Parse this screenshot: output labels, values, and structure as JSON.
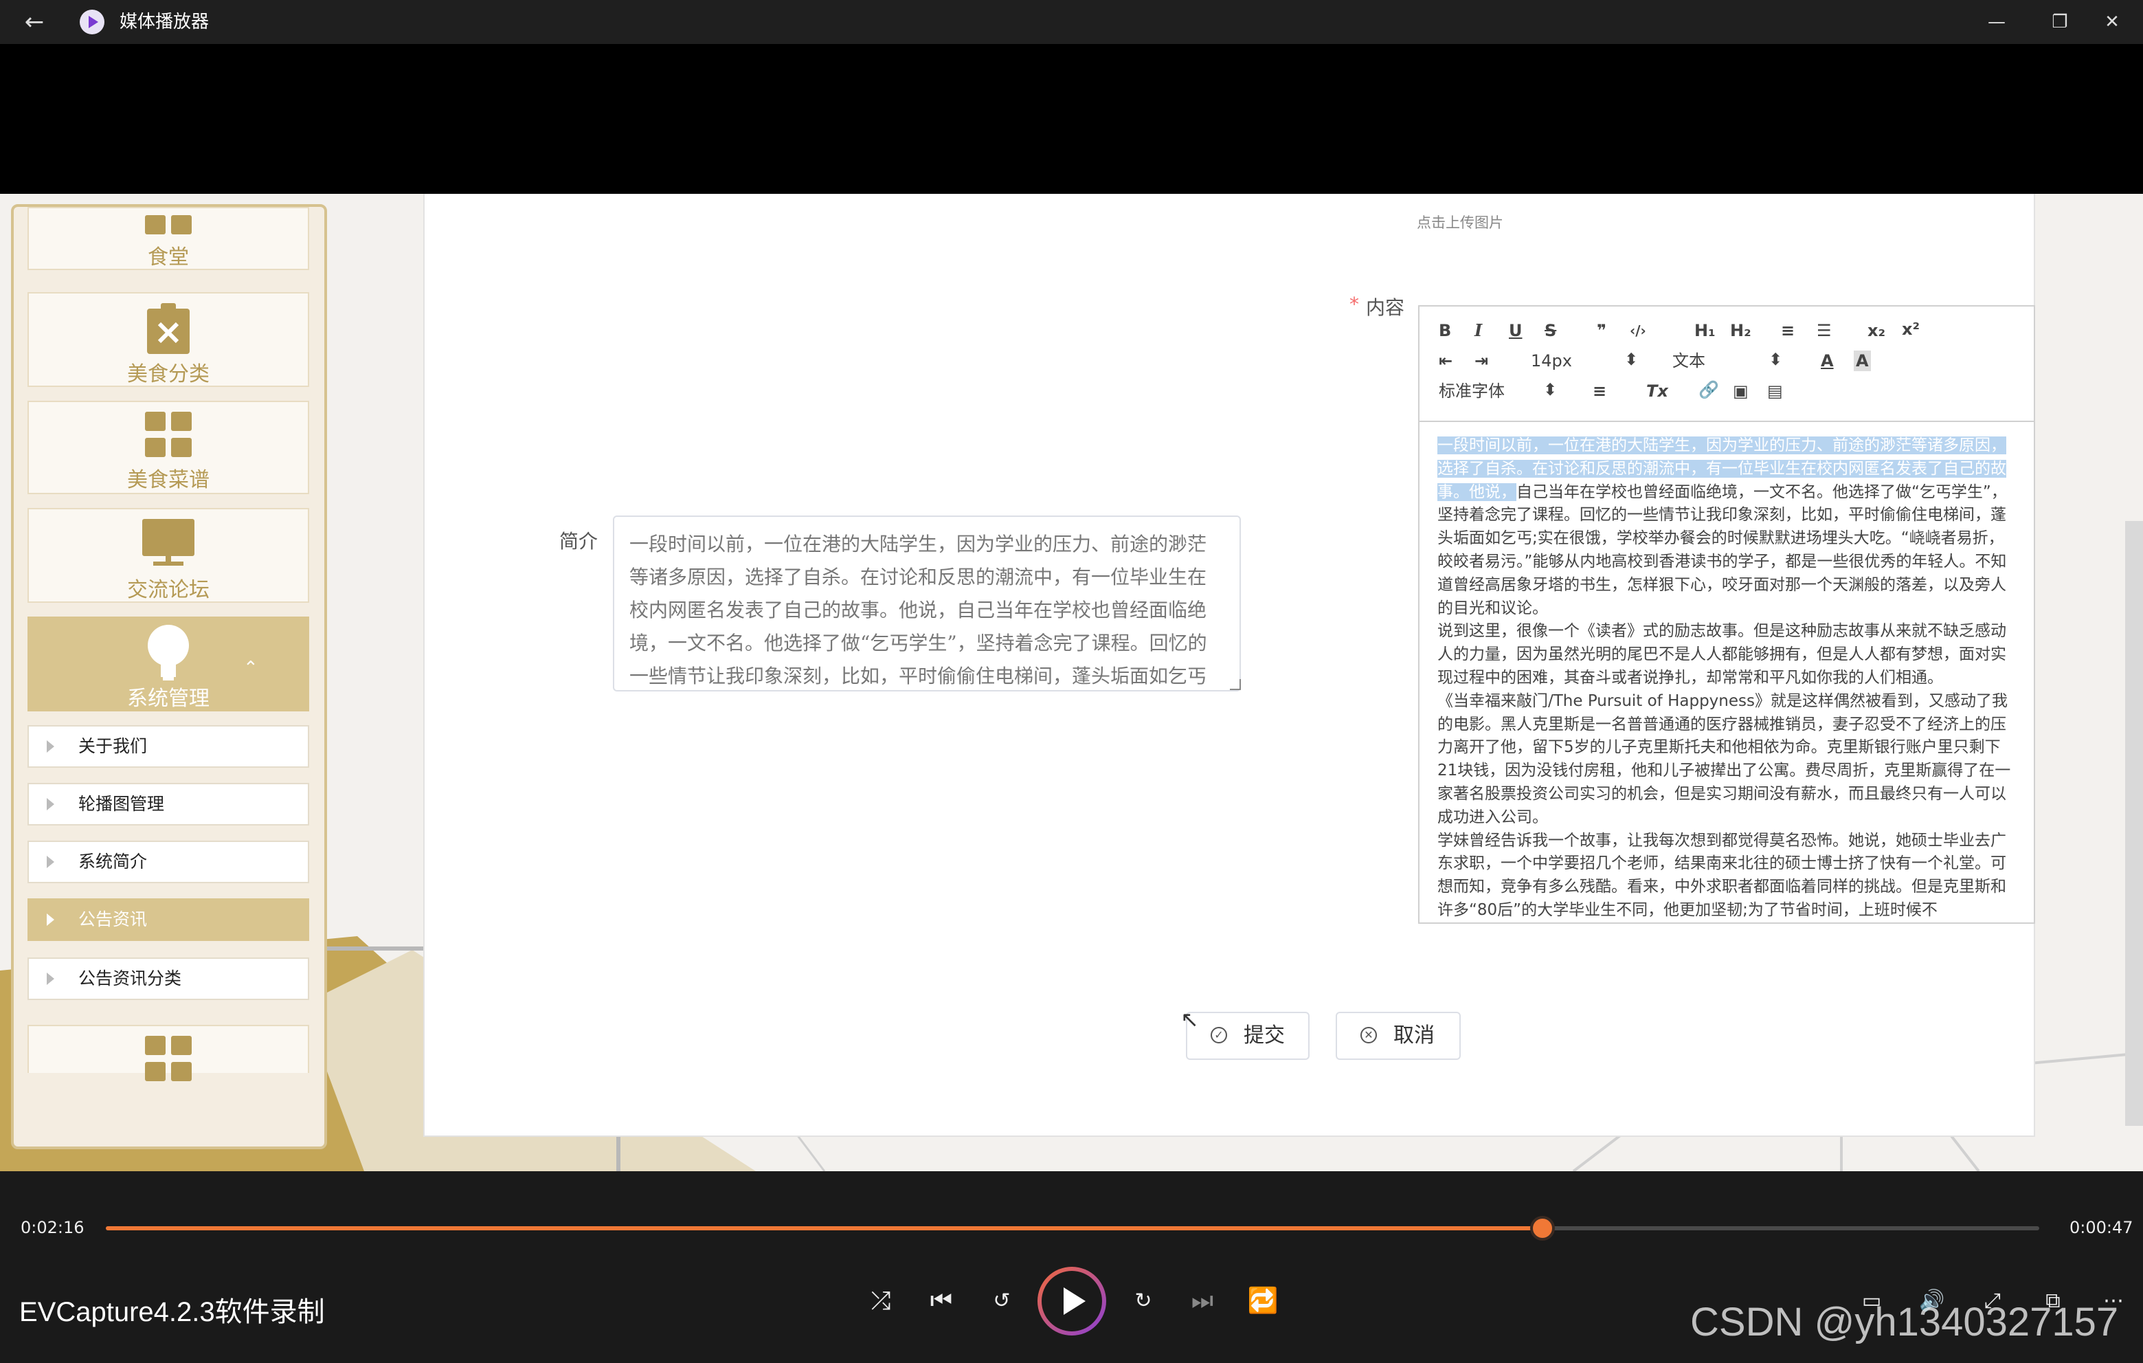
{
  "window": {
    "title": "媒体播放器",
    "back_glyph": "←",
    "minimize_glyph": "—",
    "restore_glyph": "❐",
    "close_glyph": "✕"
  },
  "sidebar": {
    "tiles": [
      {
        "label": "食堂",
        "icon": "grid-icon"
      },
      {
        "label": "美食分类",
        "icon": "clipboard-x-icon"
      },
      {
        "label": "美食菜谱",
        "icon": "grid-icon"
      },
      {
        "label": "交流论坛",
        "icon": "monitor-icon"
      },
      {
        "label": "系统管理",
        "icon": "lightbulb-icon",
        "expanded": true
      }
    ],
    "items": [
      {
        "label": "关于我们",
        "active": false
      },
      {
        "label": "轮播图管理",
        "active": false
      },
      {
        "label": "系统简介",
        "active": false
      },
      {
        "label": "公告资讯",
        "active": true
      },
      {
        "label": "公告资讯分类",
        "active": false
      }
    ]
  },
  "form": {
    "upload_hint": "点击上传图片",
    "content_required_mark": "*",
    "content_label": "内容",
    "intro_label": "简介",
    "intro_value": "一段时间以前，一位在港的大陆学生，因为学业的压力、前途的渺茫等诸多原因，选择了自杀。在讨论和反思的潮流中，有一位毕业生在校内网匿名发表了自己的故事。他说，自己当年在学校也曾经面临绝境，一文不名。他选择了做“乞丐学生”，坚持着念完了课程。回忆的一些情节让我印象深刻，比如，平时偷偷住电梯间，蓬头垢面如乞丐实在很饿，学校举办餐会的时候默默进场埋头大吃。",
    "toolbar": {
      "font_size": "14px",
      "block_format": "文本",
      "font_family": "标准字体",
      "bold": "B",
      "italic": "I",
      "underline": "U",
      "strike": "S",
      "quote": "❞",
      "code": "‹/›",
      "h1": "H₁",
      "h2": "H₂",
      "ordered_list": "≡",
      "bullet_list": "☰",
      "subscript": "x₂",
      "superscript": "x²",
      "outdent": "⇤",
      "indent": "⇥",
      "align": "≡",
      "clear_format": "Tx",
      "font_color": "A",
      "background_color": "A"
    },
    "content_selected": "一段时间以前，一位在港的大陆学生，因为学业的压力、前途的渺茫等诸多原因，选择了自杀。在讨论和反思的潮流中，有一位毕业生在校内网匿名发表了自己的故事。他说，",
    "content_paragraphs": [
      "自己当年在学校也曾经面临绝境，一文不名。他选择了做“乞丐学生”，坚持着念完了课程。回忆的一些情节让我印象深刻，比如，平时偷偷住电梯间，蓬头垢面如乞丐;实在很饿，学校举办餐会的时候默默进场埋头大吃。“峣峣者易折，皎皎者易污。”能够从内地高校到香港读书的学子，都是一些很优秀的年轻人。不知道曾经高居象牙塔的书生，怎样狠下心，咬牙面对那一个天渊般的落差，以及旁人的目光和议论。",
      "说到这里，很像一个《读者》式的励志故事。但是这种励志故事从来就不缺乏感动人的力量，因为虽然光明的尾巴不是人人都能够拥有，但是人人都有梦想，面对实现过程中的困难，其奋斗或者说挣扎，却常常和平凡如你我的人们相通。",
      "《当幸福来敲门/The Pursuit of Happyness》就是这样偶然被看到，又感动了我的电影。黑人克里斯是一名普普通通的医疗器械推销员，妻子忍受不了经济上的压力离开了他，留下5岁的儿子克里斯托夫和他相依为命。克里斯银行账户里只剩下21块钱，因为没钱付房租，他和儿子被撵出了公寓。费尽周折，克里斯赢得了在一家著名股票投资公司实习的机会，但是实习期间没有薪水，而且最终只有一人可以成功进入公司。",
      "学妹曾经告诉我一个故事，让我每次想到都觉得莫名恐怖。她说，她硕士毕业去广东求职，一个中学要招几个老师，结果南来北往的硕士博士挤了快有一个礼堂。可想而知，竞争有多么残酷。看来，中外求职者都面临着同样的挑战。但是克里斯和许多“80后”的大学毕业生不同，他更加坚韧;为了节省时间，上班时候不"
    ],
    "submit_label": "提交",
    "cancel_label": "取消"
  },
  "player": {
    "elapsed": "0:02:16",
    "remaining": "0:00:47",
    "progress_fraction": 0.743,
    "caption": "EVCapture4.2.3软件录制",
    "watermark": "CSDN @yh1340327157",
    "icons": [
      "shuffle-icon",
      "previous-icon",
      "rewind-10-icon",
      "play-icon",
      "forward-30-icon",
      "next-icon",
      "repeat-icon"
    ],
    "accent": "#f07836"
  }
}
